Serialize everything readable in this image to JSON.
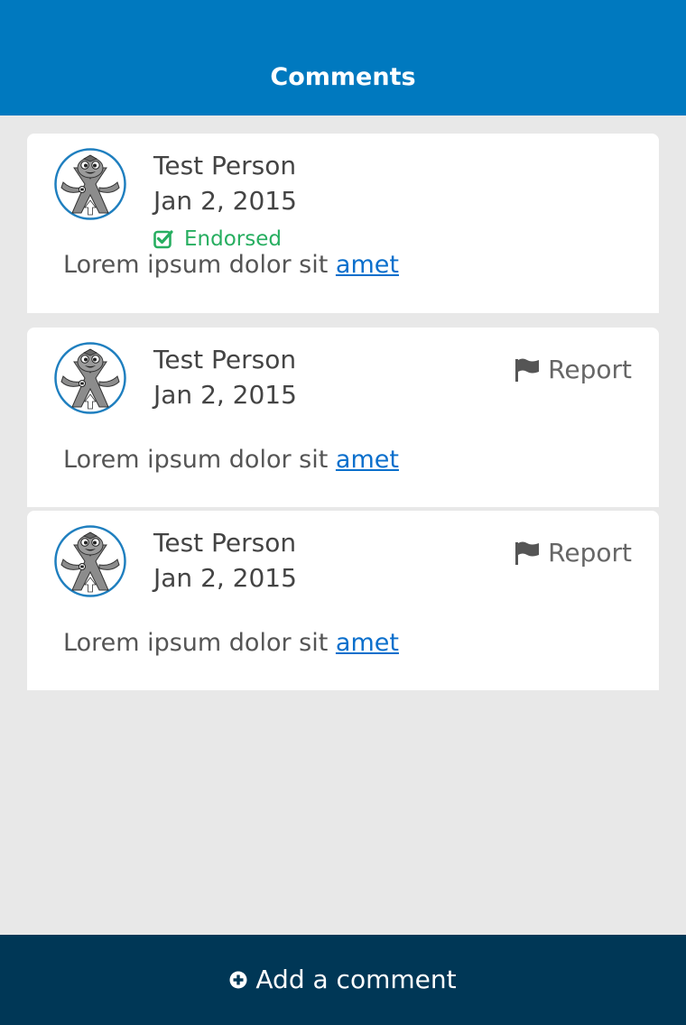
{
  "header": {
    "title": "Comments",
    "background": "#0079bf"
  },
  "comments": [
    {
      "author": "Test Person",
      "date": "Jan 2, 2015",
      "endorsed": true,
      "endorsed_label": "Endorsed",
      "avatar_icon": "robot-mascot-avatar",
      "body_text": "Lorem ipsum dolor sit ",
      "body_link": "amet"
    },
    {
      "author": "Test Person",
      "date": "Jan 2, 2015",
      "endorsed": false,
      "report_label": "Report",
      "report_icon": "flag-icon",
      "avatar_icon": "robot-mascot-avatar",
      "body_text": "Lorem ipsum dolor sit ",
      "body_link": "amet"
    },
    {
      "author": "Test Person",
      "date": "Jan 2, 2015",
      "endorsed": false,
      "report_label": "Report",
      "report_icon": "flag-icon",
      "avatar_icon": "robot-mascot-avatar",
      "body_text": "Lorem ipsum dolor sit ",
      "body_link": "amet"
    }
  ],
  "footer": {
    "add_comment_label": "Add a comment",
    "icon": "plus-circle-icon",
    "background": "#003756"
  },
  "colors": {
    "page_background": "#e8e8e8",
    "card_background": "#ffffff",
    "endorsed_green": "#27ae60",
    "link_blue": "#0a6fcc"
  }
}
